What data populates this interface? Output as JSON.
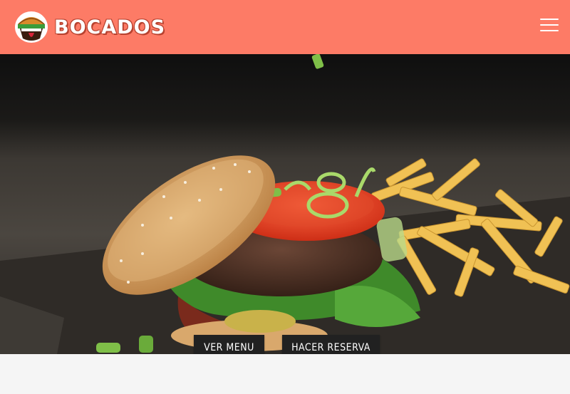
{
  "header": {
    "brand": "BOCADOS",
    "logo_icon": "burger-mascot-icon",
    "menu_icon": "hamburger-menu-icon",
    "background_color": "#fd7b66"
  },
  "hero": {
    "image": "burger-and-fries-photo"
  },
  "actions": {
    "menu_label": "VER MENU",
    "reserve_label": "HACER RESERVA"
  }
}
